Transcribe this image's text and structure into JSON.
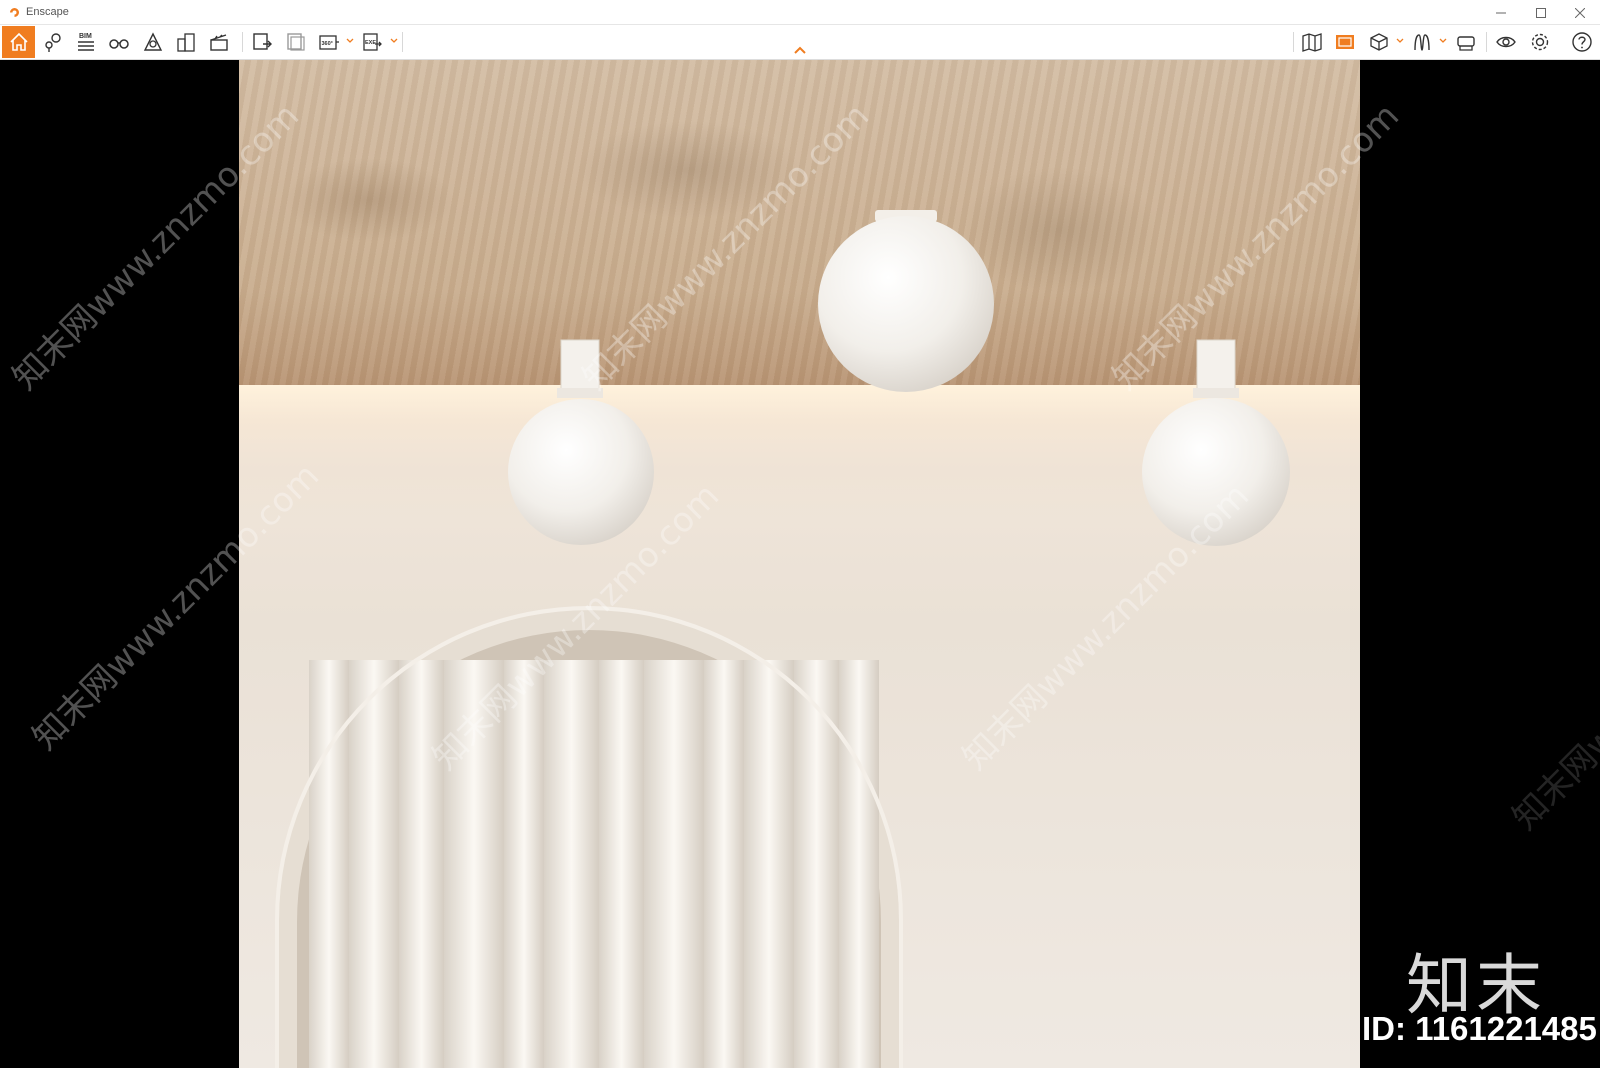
{
  "window": {
    "title": "Enscape"
  },
  "colors": {
    "accent": "#f07d20",
    "background": "#000000",
    "toolbar": "#ffffff"
  },
  "toolbar": {
    "left_tools": [
      {
        "name": "home-icon",
        "active": true
      },
      {
        "name": "views-icon"
      },
      {
        "name": "bim-icon",
        "label": "BIM"
      },
      {
        "name": "binoculars-icon"
      },
      {
        "name": "sun-icon"
      },
      {
        "name": "buildings-icon"
      },
      {
        "name": "clapper-icon"
      },
      {
        "name": "screenshot-export-icon"
      },
      {
        "name": "batch-export-icon"
      },
      {
        "name": "panorama-export-icon",
        "label": "360°"
      },
      {
        "name": "exe-export-icon",
        "label": "EXE"
      }
    ],
    "right_tools": [
      {
        "name": "map-icon"
      },
      {
        "name": "render-panel-icon",
        "active": true
      },
      {
        "name": "box-icon"
      },
      {
        "name": "asset-icon"
      },
      {
        "name": "vr-headset-icon"
      },
      {
        "name": "eye-icon"
      },
      {
        "name": "settings-icon"
      },
      {
        "name": "help-icon"
      }
    ]
  },
  "watermark": {
    "site": "知末网www.znzmo.com",
    "brand": "知末",
    "id_label": "ID: 1161221485"
  }
}
